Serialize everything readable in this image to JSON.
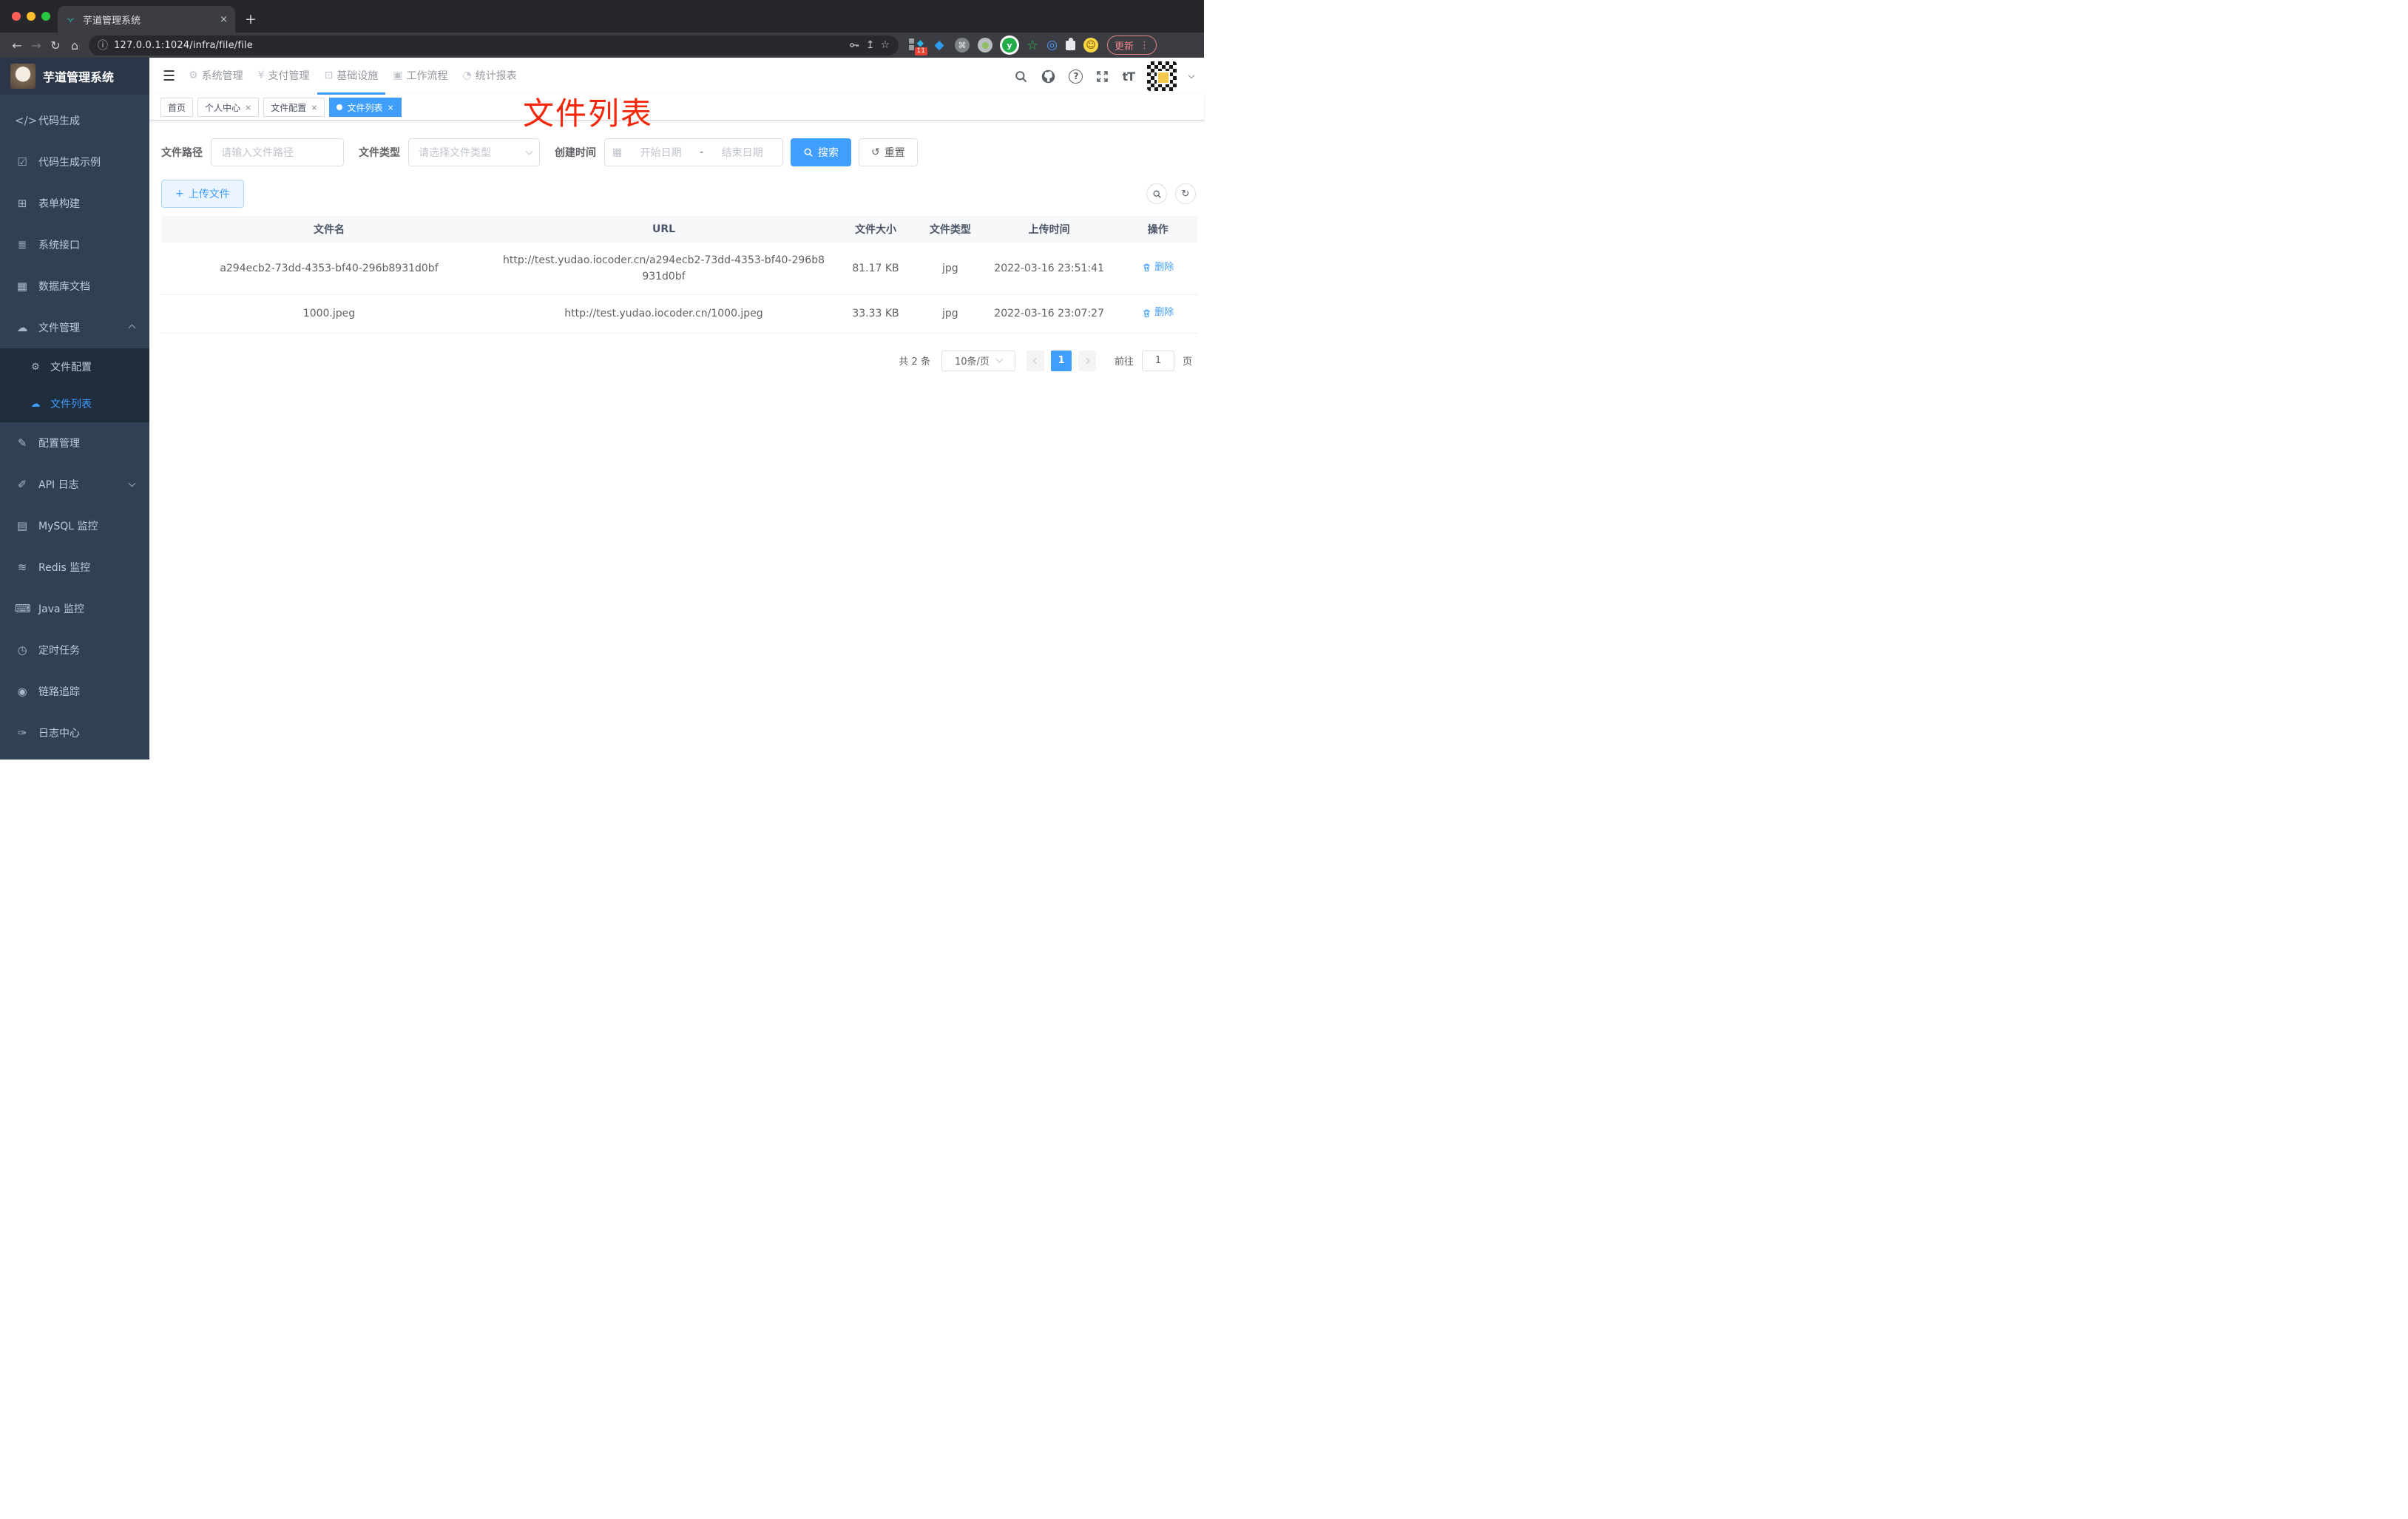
{
  "colors": {
    "accent": "#409eff",
    "sidebar_bg": "#304156",
    "submenu_bg": "#1f2d3d",
    "annotation_red": "#f4270b",
    "danger_badge": "#e94235"
  },
  "icons": {
    "close": "×",
    "plus": "+",
    "back": "←",
    "forward": "→",
    "reload": "↻",
    "home": "⌂",
    "info": "ⓘ",
    "share": "↥",
    "star": "☆",
    "more": "⋮",
    "menu": "☰",
    "command": "⌘",
    "smile": "☺",
    "diamond": "◆",
    "eye_ext": "◎",
    "star_ext": "☆",
    "y_letter": "y",
    "question": "?",
    "font_size": "tT",
    "reset": "↺",
    "refresh": "↻",
    "dot": "●",
    "calendar": "▦",
    "dash": "-"
  },
  "browser": {
    "tab_title": "芋道管理系统",
    "url": "127.0.0.1:1024/infra/file/file",
    "update_label": "更新",
    "extension_badge": "11"
  },
  "header": {
    "logo_title": "芋道管理系统",
    "nav": [
      {
        "label": "系统管理",
        "glyph": "⚙"
      },
      {
        "label": "支付管理",
        "glyph": "¥"
      },
      {
        "label": "基础设施",
        "glyph": "⊡",
        "active": true
      },
      {
        "label": "工作流程",
        "glyph": "▣"
      },
      {
        "label": "统计报表",
        "glyph": "◔"
      }
    ]
  },
  "sidebar": {
    "items_top": [
      {
        "label": "代码生成",
        "glyph": "</>"
      },
      {
        "label": "代码生成示例",
        "glyph": "☑"
      },
      {
        "label": "表单构建",
        "glyph": "⊞"
      },
      {
        "label": "系统接口",
        "glyph": "≣"
      },
      {
        "label": "数据库文档",
        "glyph": "▦"
      },
      {
        "label": "文件管理",
        "glyph": "☁",
        "expanded": true
      }
    ],
    "submenu": [
      {
        "label": "文件配置",
        "glyph": "⚙"
      },
      {
        "label": "文件列表",
        "glyph": "☁",
        "active": true
      }
    ],
    "items_bottom": [
      {
        "label": "配置管理",
        "glyph": "✎"
      },
      {
        "label": "API 日志",
        "glyph": "✐",
        "has_children": true
      },
      {
        "label": "MySQL 监控",
        "glyph": "▤"
      },
      {
        "label": "Redis 监控",
        "glyph": "≋"
      },
      {
        "label": "Java 监控",
        "glyph": "⌨"
      },
      {
        "label": "定时任务",
        "glyph": "◷"
      },
      {
        "label": "链路追踪",
        "glyph": "◉"
      },
      {
        "label": "日志中心",
        "glyph": "✑"
      }
    ]
  },
  "tags": [
    {
      "label": "首页",
      "closable": false
    },
    {
      "label": "个人中心",
      "closable": true
    },
    {
      "label": "文件配置",
      "closable": true
    },
    {
      "label": "文件列表",
      "closable": true,
      "active": true
    }
  ],
  "annotation": {
    "text": "文件列表"
  },
  "filters": {
    "path_label": "文件路径",
    "path_placeholder": "请输入文件路径",
    "type_label": "文件类型",
    "type_placeholder": "请选择文件类型",
    "time_label": "创建时间",
    "start_placeholder": "开始日期",
    "separator": "-",
    "end_placeholder": "结束日期",
    "search_label": "搜索",
    "reset_label": "重置"
  },
  "toolbar": {
    "upload_label": "上传文件"
  },
  "table": {
    "headers": [
      "文件名",
      "URL",
      "文件大小",
      "文件类型",
      "上传时间",
      "操作"
    ],
    "rows": [
      {
        "name": "a294ecb2-73dd-4353-bf40-296b8931d0bf",
        "url": "http://test.yudao.iocoder.cn/a294ecb2-73dd-4353-bf40-296b8931d0bf",
        "size": "81.17 KB",
        "type": "jpg",
        "time": "2022-03-16 23:51:41",
        "action": "删除"
      },
      {
        "name": "1000.jpeg",
        "url": "http://test.yudao.iocoder.cn/1000.jpeg",
        "size": "33.33 KB",
        "type": "jpg",
        "time": "2022-03-16 23:07:27",
        "action": "删除"
      }
    ]
  },
  "pagination": {
    "total": "共 2 条",
    "page_size": "10条/页",
    "current": "1",
    "goto_label": "前往",
    "goto_value": "1",
    "unit": "页"
  }
}
